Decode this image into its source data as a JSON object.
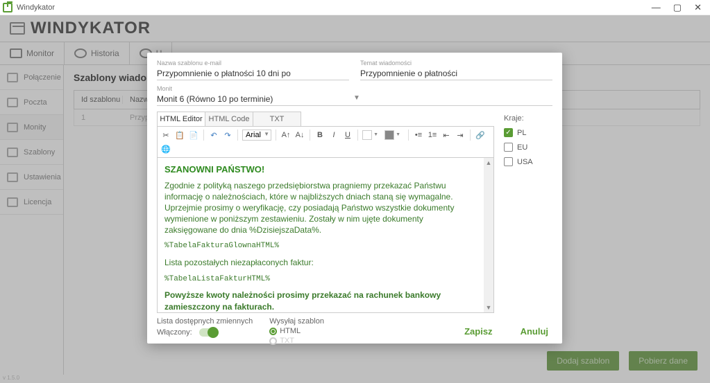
{
  "window": {
    "title": "Windykator"
  },
  "app": {
    "name": "WINDYKATOR"
  },
  "toolbar": {
    "monitor": "Monitor",
    "history": "Historia",
    "settings_prefix": "U"
  },
  "sidebar": {
    "items": [
      {
        "label": "Połączenie"
      },
      {
        "label": "Poczta"
      },
      {
        "label": "Monity"
      },
      {
        "label": "Szablony"
      },
      {
        "label": "Ustawienia"
      },
      {
        "label": "Licencja"
      }
    ]
  },
  "content": {
    "heading": "Szablony wiadom",
    "columns": {
      "id": "Id szablonu",
      "name": "Nazwa"
    },
    "row": {
      "id": "1",
      "name": "Przypom"
    },
    "buttons": {
      "add": "Dodaj szablon",
      "fetch": "Pobierz dane"
    }
  },
  "dialog": {
    "fields": {
      "template_name_label": "Nazwa szablonu e-mail",
      "template_name_value": "Przypomnienie o płatności 10 dni po",
      "subject_label": "Temat wiadomości",
      "subject_value": "Przypomnienie o płatności",
      "monit_label": "Monit",
      "monit_value": "Monit 6 (Równo 10 po terminie)"
    },
    "tabs": {
      "editor": "HTML Editor",
      "code": "HTML Code",
      "txt": "TXT"
    },
    "font": "Arial",
    "body": {
      "heading": "SZANOWNI PAŃSTWO!",
      "para1": "Zgodnie z polityką naszego przedsiębiorstwa pragniemy przekazać Państwu informację o należnościach, które w najbliższych dniach staną się wymagalne. Uprzejmie prosimy o weryfikację, czy posiadają Państwo wszystkie dokumenty wymienione w poniższym zestawieniu. Zostały w nim ujęte dokumenty zaksięgowane do dnia %DzisiejszaData%.",
      "code1": "%TabelaFakturaGlownaHTML%",
      "para2": "Lista pozostałych niezapłaconych faktur:",
      "code2": "%TabelaListaFakturHTML%",
      "para3": "Powyższe kwoty należności prosimy przekazać na rachunek bankowy zamieszczony na fakturach."
    },
    "below": {
      "vars": "Lista dostępnych zmiennych",
      "send_as": "Wysyłaj szablon",
      "html": "HTML",
      "txt": "TXT",
      "enabled": "Włączony:"
    },
    "countries": {
      "title": "Kraje:",
      "pl": "PL",
      "eu": "EU",
      "usa": "USA"
    },
    "buttons": {
      "save": "Zapisz",
      "cancel": "Anuluj"
    }
  },
  "footer": {
    "version": "v 1.5.0"
  }
}
